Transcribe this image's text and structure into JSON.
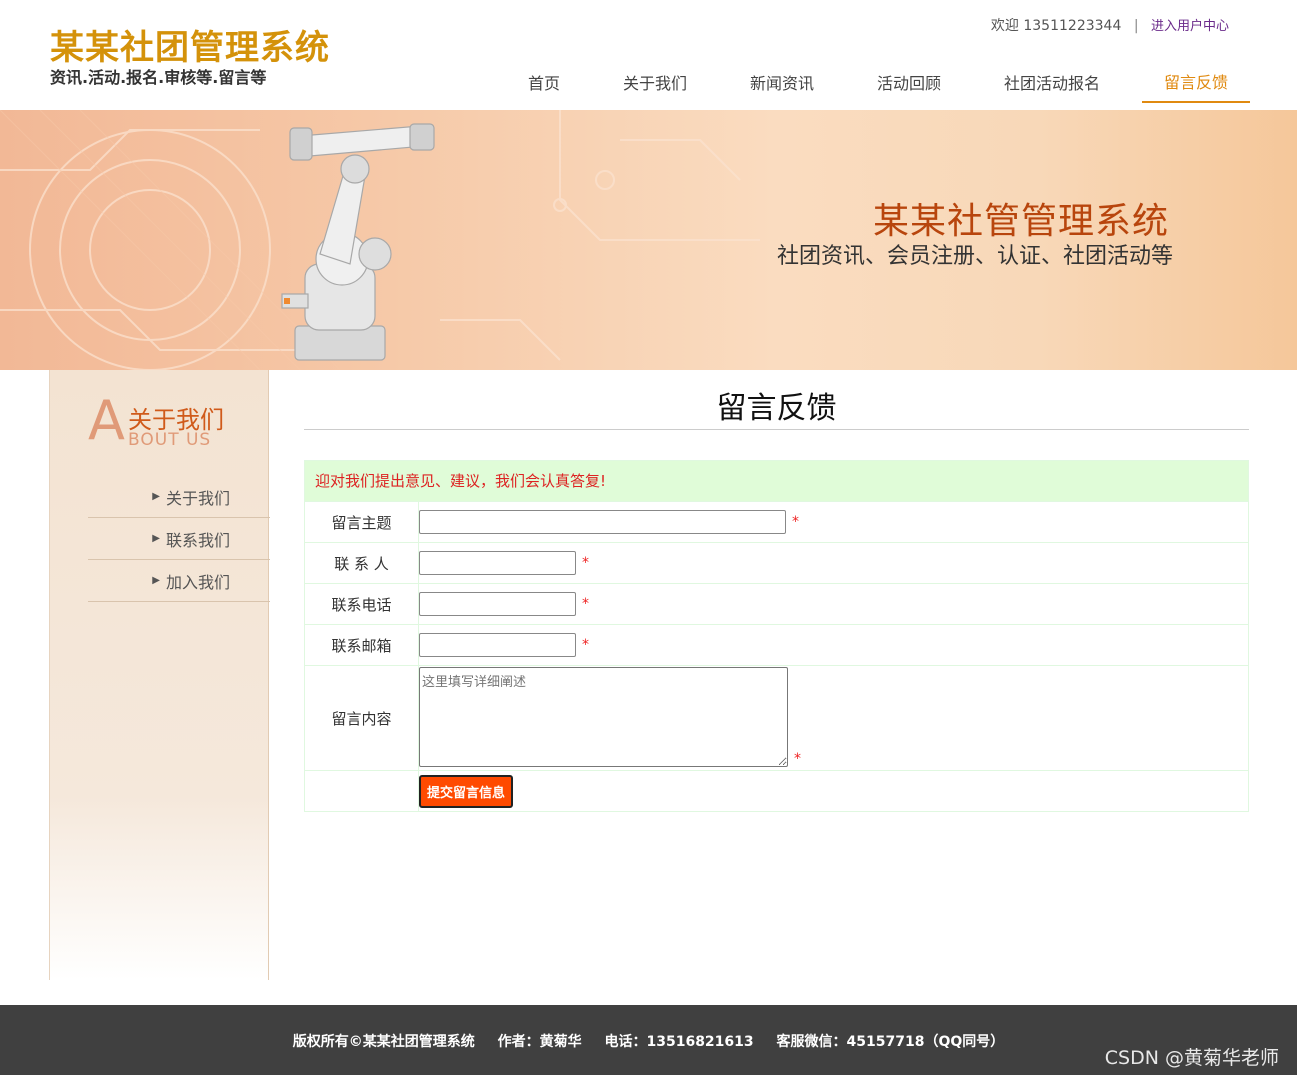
{
  "header": {
    "logo_title": "某某社团管理系统",
    "logo_subtitle": "资讯.活动.报名.审核等.留言等",
    "welcome": "欢迎 13511223344",
    "separator": "|",
    "user_center_link": "进入用户中心"
  },
  "nav": {
    "items": [
      {
        "label": "首页"
      },
      {
        "label": "关于我们"
      },
      {
        "label": "新闻资讯"
      },
      {
        "label": "活动回顾"
      },
      {
        "label": "社团活动报名"
      },
      {
        "label": "留言反馈"
      }
    ],
    "active_index": 5
  },
  "banner": {
    "title": "某某社管管理系统",
    "subtitle": "社团资讯、会员注册、认证、社团活动等"
  },
  "sidebar": {
    "heading_letter": "A",
    "heading_cn": "关于我们",
    "heading_en": "BOUT US",
    "items": [
      {
        "label": "关于我们"
      },
      {
        "label": "联系我们"
      },
      {
        "label": "加入我们"
      }
    ]
  },
  "main": {
    "title": "留言反馈",
    "notice": "迎对我们提出意见、建议，我们会认真答复!",
    "form": {
      "subject_label": "留言主题",
      "contact_label": "联 系 人",
      "phone_label": "联系电话",
      "email_label": "联系邮箱",
      "content_label": "留言内容",
      "content_placeholder": "这里填写详细阐述",
      "required_mark": "*",
      "submit_label": "提交留言信息"
    }
  },
  "footer": {
    "copyright": "版权所有©某某社团管理系统",
    "author": "作者：黄菊华",
    "phone": "电话：13516821613",
    "wechat": "客服微信：45157718（QQ同号）",
    "watermark": "CSDN @黄菊华老师"
  },
  "colors": {
    "accent": "#e08a10",
    "logo": "#d4920a",
    "banner_title": "#b8450d",
    "submit": "#ff4a00",
    "notice_bg": "#e0fcd8",
    "footer_bg": "#404040"
  }
}
